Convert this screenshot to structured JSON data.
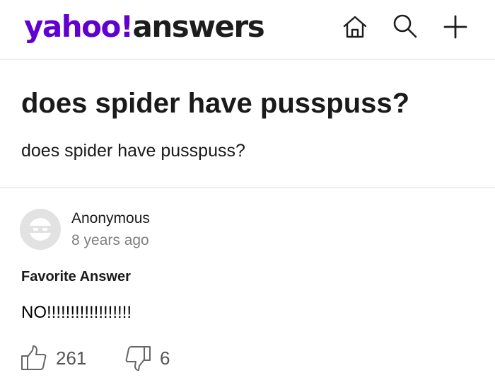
{
  "header": {
    "logo": {
      "yahoo": "yahoo!",
      "answers": "answers",
      "brand_color": "#6001d2"
    },
    "icons": [
      "home-icon",
      "search-icon",
      "plus-icon"
    ]
  },
  "question": {
    "title": "does spider have pusspuss?",
    "body": "does spider have pusspuss?"
  },
  "answer": {
    "author": "Anonymous",
    "time": "8 years ago",
    "label": "Favorite Answer",
    "text": "NO!!!!!!!!!!!!!!!!!!",
    "thumbs_up_count": "261",
    "thumbs_down_count": "6",
    "avatar_icon": "anonymous-mask-icon"
  }
}
